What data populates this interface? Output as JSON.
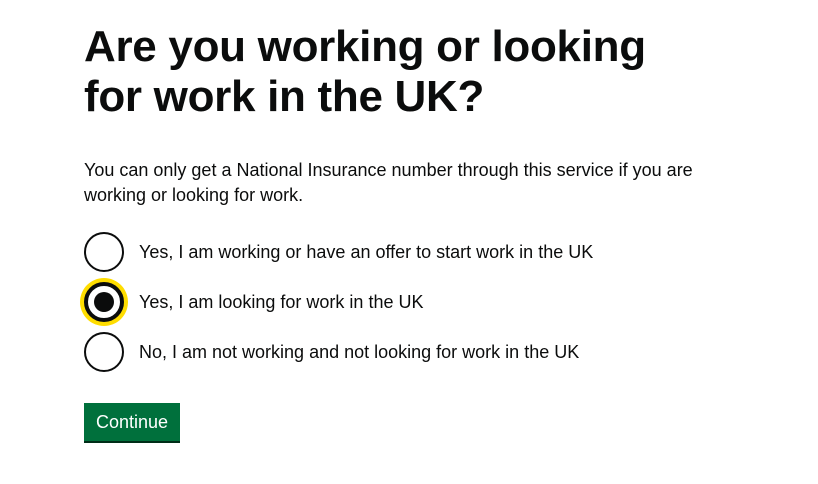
{
  "question": {
    "title": "Are you working or looking for work in the UK?",
    "hint": "You can only get a National Insurance number through this service if you are working or looking for work."
  },
  "options": [
    {
      "label": "Yes, I am working or have an offer to start work in the UK",
      "checked": false
    },
    {
      "label": "Yes, I am looking for work in the UK",
      "checked": true,
      "focused": true
    },
    {
      "label": "No, I am not working and not looking for work in the UK",
      "checked": false
    }
  ],
  "actions": {
    "continue_label": "Continue"
  },
  "colors": {
    "text": "#0b0c0c",
    "button": "#00703c",
    "focus": "#ffdd00",
    "background": "#ffffff"
  }
}
